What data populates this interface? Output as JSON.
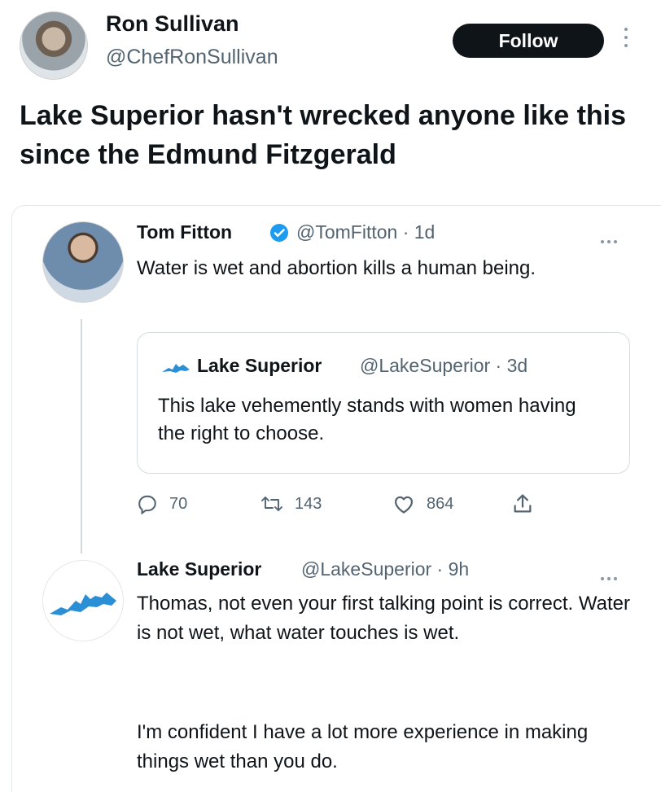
{
  "header": {
    "author_name": "Ron Sullivan",
    "author_handle": "@ChefRonSullivan",
    "follow_label": "Follow",
    "main_text": "Lake Superior hasn't wrecked anyone like this since the Edmund Fitzgerald"
  },
  "thread": {
    "original": {
      "name": "Tom Fitton",
      "handle_time": "@TomFitton · 1d",
      "text": "Water is wet and abortion kills a human being.",
      "quote": {
        "name": "Lake Superior",
        "handle_time": "@LakeSuperior · 3d",
        "text": "This lake vehemently stands with women having the right to choose."
      },
      "actions": {
        "replies": "70",
        "retweets": "143",
        "likes": "864"
      }
    },
    "reply": {
      "name": "Lake Superior",
      "handle_time": "@LakeSuperior · 9h",
      "text_1": "Thomas, not even your first talking point is correct. Water is not wet, what water touches is wet.",
      "text_2": "I'm confident I have a lot more experience in making things wet than you do."
    }
  },
  "colors": {
    "text_primary": "#0f1419",
    "text_secondary": "#536471",
    "verified_blue": "#1d9bf0",
    "lake_blue": "#2b8fd6",
    "follow_bg": "#0f1419"
  }
}
